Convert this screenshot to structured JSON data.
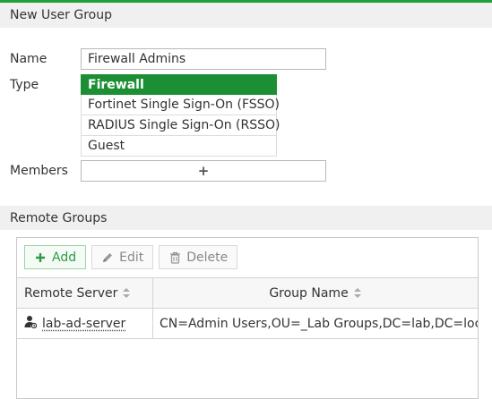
{
  "header": {
    "title": "New User Group"
  },
  "form": {
    "name_label": "Name",
    "name_value": "Firewall Admins",
    "type_label": "Type",
    "type_options": [
      {
        "label": "Firewall",
        "selected": true
      },
      {
        "label": "Fortinet Single Sign-On (FSSO)",
        "selected": false
      },
      {
        "label": "RADIUS Single Sign-On (RSSO)",
        "selected": false
      },
      {
        "label": "Guest",
        "selected": false
      }
    ],
    "members_label": "Members",
    "members_add_symbol": "+"
  },
  "remote_groups": {
    "title": "Remote Groups",
    "toolbar": {
      "add_label": "Add",
      "edit_label": "Edit",
      "delete_label": "Delete"
    },
    "columns": [
      "Remote Server",
      "Group Name"
    ],
    "rows": [
      {
        "remote_server": "lab-ad-server",
        "group_name": "CN=Admin Users,OU=_Lab Groups,DC=lab,DC=local"
      }
    ]
  },
  "colors": {
    "accent": "#1f9e3a",
    "selected_bg": "#1c8f34",
    "add_button": "#2e9a45"
  },
  "icons": {
    "add": "plus-icon",
    "edit": "pencil-icon",
    "delete": "trash-icon",
    "sort": "sort-icon",
    "server": "user-server-icon"
  }
}
